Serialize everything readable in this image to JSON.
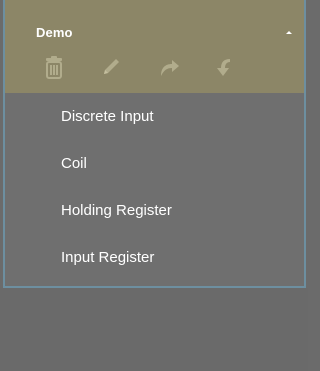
{
  "panel": {
    "title": "Demo",
    "collapse_icon": "chevron-up-icon",
    "colors": {
      "header_bg": "#8c8667",
      "menu_bg": "#6f6f6f",
      "icon_color": "#b1ac8c",
      "border": "#6d8fa0",
      "text": "#ffffff"
    }
  },
  "toolbar": {
    "items": [
      {
        "icon": "trash-icon"
      },
      {
        "icon": "pencil-icon"
      },
      {
        "icon": "redo-arrow-icon"
      },
      {
        "icon": "undo-arrow-icon"
      }
    ]
  },
  "menu": {
    "items": [
      {
        "label": "Discrete Input"
      },
      {
        "label": "Coil"
      },
      {
        "label": "Holding Register"
      },
      {
        "label": "Input Register"
      }
    ]
  }
}
